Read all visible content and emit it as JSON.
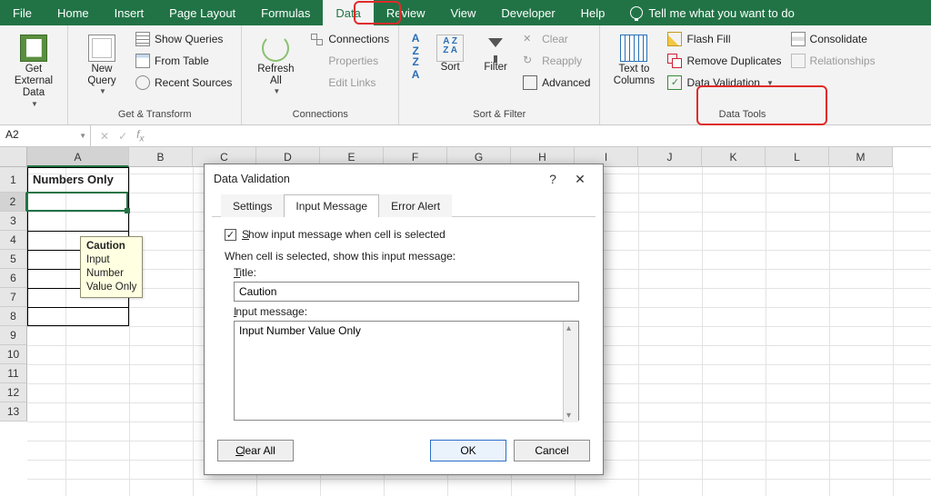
{
  "tabs": [
    "File",
    "Home",
    "Insert",
    "Page Layout",
    "Formulas",
    "Data",
    "Review",
    "View",
    "Developer",
    "Help"
  ],
  "active_tab_index": 5,
  "tellme": "Tell me what you want to do",
  "ribbon": {
    "get_external": "Get External\nData",
    "new_query": "New\nQuery",
    "show_queries": "Show Queries",
    "from_table": "From Table",
    "recent_sources": "Recent Sources",
    "group_get_transform": "Get & Transform",
    "refresh_all": "Refresh\nAll",
    "connections": "Connections",
    "properties": "Properties",
    "edit_links": "Edit Links",
    "group_connections": "Connections",
    "sort": "Sort",
    "filter": "Filter",
    "clear": "Clear",
    "reapply": "Reapply",
    "advanced": "Advanced",
    "group_sort_filter": "Sort & Filter",
    "text_to_columns": "Text to\nColumns",
    "flash_fill": "Flash Fill",
    "remove_duplicates": "Remove Duplicates",
    "data_validation": "Data Validation",
    "consolidate": "Consolidate",
    "relationships": "Relationships",
    "group_data_tools": "Data Tools"
  },
  "namebox": "A2",
  "columns": [
    "A",
    "B",
    "C",
    "D",
    "E",
    "F",
    "G",
    "H",
    "I",
    "J",
    "K",
    "L",
    "M"
  ],
  "rows": [
    "1",
    "2",
    "3",
    "4",
    "5",
    "6",
    "7",
    "8",
    "9",
    "10",
    "11",
    "12",
    "13"
  ],
  "a1": "Numbers Only",
  "tooltip": {
    "title": "Caution",
    "body": "Input\nNumber\nValue Only"
  },
  "dialog": {
    "title": "Data Validation",
    "tabs": [
      "Settings",
      "Input Message",
      "Error Alert"
    ],
    "active_tab_index": 1,
    "chk_label": "Show input message when cell is selected",
    "chk_checked": true,
    "intro": "When cell is selected, show this input message:",
    "title_label": "Title:",
    "title_value": "Caution",
    "msg_label": "Input message:",
    "msg_value": "Input Number Value Only",
    "clear_all": "Clear All",
    "ok": "OK",
    "cancel": "Cancel"
  }
}
